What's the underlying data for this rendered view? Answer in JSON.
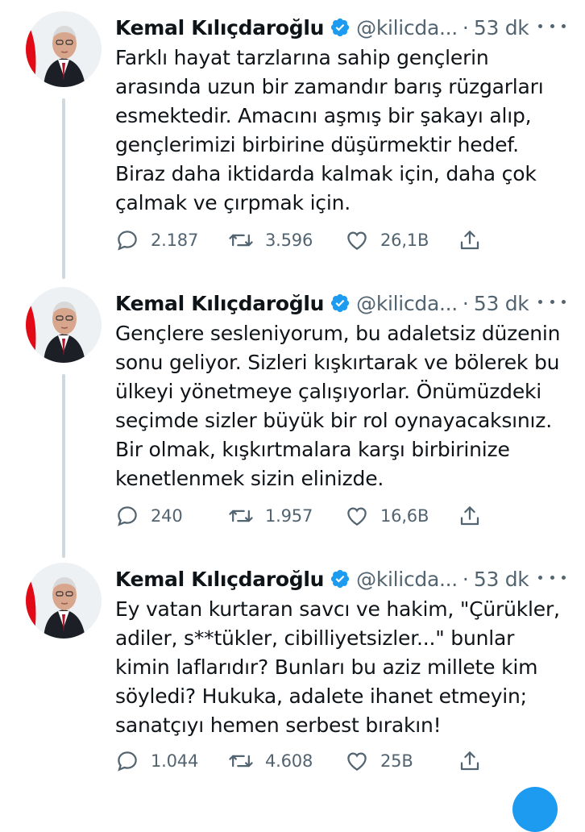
{
  "colors": {
    "accent": "#1d9bf0",
    "text_primary": "#0f1419",
    "text_secondary": "#536471",
    "thread_line": "#cfd9de"
  },
  "tweets": [
    {
      "author_name": "Kemal Kılıçdaroğlu",
      "handle": "@kilicda...",
      "separator": "·",
      "time": "53 dk",
      "text": "Farklı hayat tarzlarına sahip gençlerin\narasında uzun bir zamandır barış rüzgarları\nesmektedir. Amacını aşmış bir şakayı alıp,\ngençlerimizi birbirine düşürmektir hedef.\nBiraz daha iktidarda kalmak için, daha çok\nçalmak ve çırpmak için.",
      "replies": "2.187",
      "retweets": "3.596",
      "likes": "26,1B"
    },
    {
      "author_name": "Kemal Kılıçdaroğlu",
      "handle": "@kilicda...",
      "separator": "·",
      "time": "53 dk",
      "text": "Gençlere sesleniyorum, bu adaletsiz düzenin\nsonu geliyor. Sizleri kışkırtarak ve bölerek bu\nülkeyi yönetmeye çalışıyorlar. Önümüzdeki\nseçimde sizler büyük bir rol oynayacaksınız.\nBir olmak, kışkırtmalara karşı birbirinize\nkenetlenmek sizin elinizde.",
      "replies": "240",
      "retweets": "1.957",
      "likes": "16,6B"
    },
    {
      "author_name": "Kemal Kılıçdaroğlu",
      "handle": "@kilicda...",
      "separator": "·",
      "time": "53 dk",
      "text": "Ey vatan kurtaran savcı ve hakim, \"Çürükler,\nadiler, s**tükler, cibilliyetsizler...\" bunlar\nkimin laflarıdır? Bunları bu aziz millete kim\nsöyledi? Hukuka, adalete ihanet etmeyin;\nsanatçıyı hemen serbest bırakın!",
      "replies": "1.044",
      "retweets": "4.608",
      "likes": "25B"
    }
  ]
}
